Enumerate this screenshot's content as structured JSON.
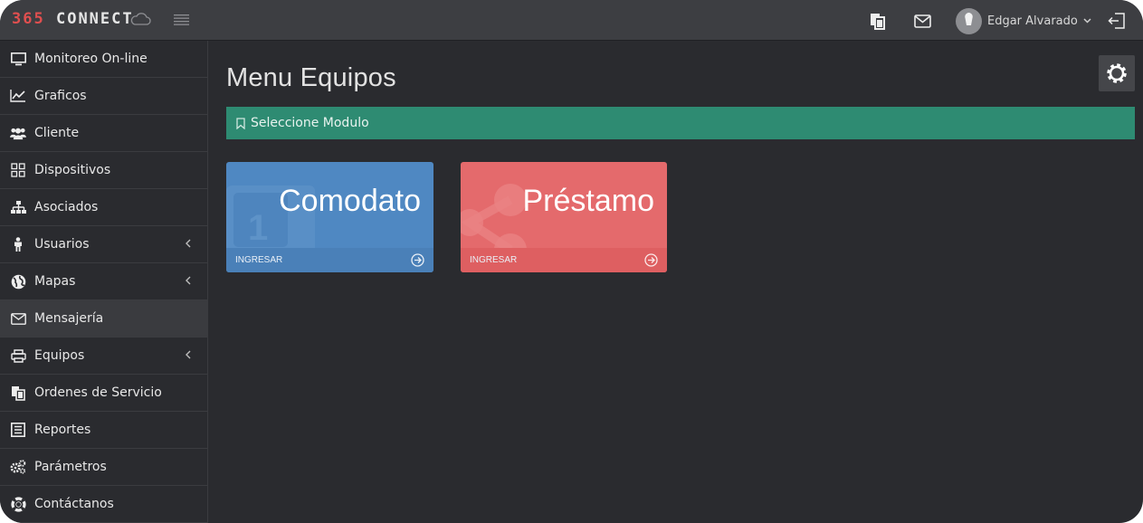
{
  "header": {
    "logo_number": "365",
    "logo_text": "CONNECT",
    "user_name": "Edgar Alvarado"
  },
  "sidebar": {
    "items": [
      {
        "label": "Monitoreo On-line",
        "icon": "monitor-icon",
        "has_submenu": false
      },
      {
        "label": "Graficos",
        "icon": "line-chart-icon",
        "has_submenu": false
      },
      {
        "label": "Cliente",
        "icon": "users-icon",
        "has_submenu": false
      },
      {
        "label": "Dispositivos",
        "icon": "grid-icon",
        "has_submenu": false
      },
      {
        "label": "Asociados",
        "icon": "sitemap-icon",
        "has_submenu": false
      },
      {
        "label": "Usuarios",
        "icon": "person-icon",
        "has_submenu": true
      },
      {
        "label": "Mapas",
        "icon": "globe-icon",
        "has_submenu": true
      },
      {
        "label": "Mensajería",
        "icon": "envelope-icon",
        "has_submenu": false,
        "active": true
      },
      {
        "label": "Equipos",
        "icon": "printer-icon",
        "has_submenu": true
      },
      {
        "label": "Ordenes de Servicio",
        "icon": "copy-icon",
        "has_submenu": false
      },
      {
        "label": "Reportes",
        "icon": "list-icon",
        "has_submenu": false
      },
      {
        "label": "Parámetros",
        "icon": "cogs-icon",
        "has_submenu": false
      },
      {
        "label": "Contáctanos",
        "icon": "lifebuoy-icon",
        "has_submenu": false
      }
    ]
  },
  "main": {
    "title": "Menu Equipos",
    "banner_text": "Seleccione Modulo",
    "tiles": [
      {
        "title": "Comodato",
        "action": "INGRESAR",
        "color": "#4f88c2"
      },
      {
        "title": "Préstamo",
        "action": "INGRESAR",
        "color": "#e46a6c"
      }
    ]
  },
  "colors": {
    "accent_green": "#2e8b72",
    "logo_red": "#e04f4f",
    "background": "#2a2b2f"
  }
}
